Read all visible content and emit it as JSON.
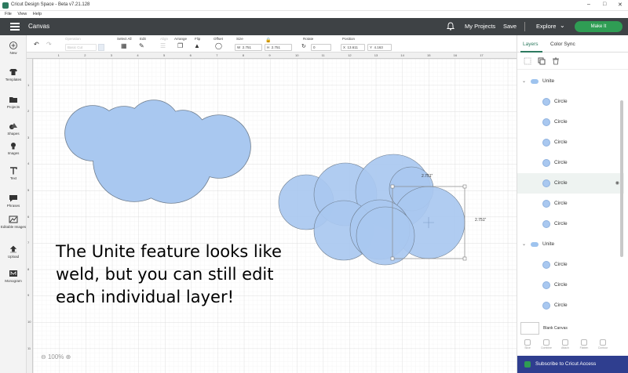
{
  "window": {
    "title": "Cricut Design Space - Beta v7.21.128",
    "menu": [
      "File",
      "View",
      "Help"
    ]
  },
  "header": {
    "canvas_label": "Canvas",
    "my_projects": "My Projects",
    "save": "Save",
    "explore": "Explore",
    "make_it": "Make It"
  },
  "toolbar": {
    "operation_label": "Operation",
    "operation_value": "Basic Cut",
    "select_all": "Select All",
    "edit": "Edit",
    "align": "Align",
    "arrange": "Arrange",
    "flip": "Flip",
    "offset": "Offset",
    "size": "Size",
    "w_label": "W",
    "w_value": "2.751",
    "h_label": "H",
    "h_value": "2.751",
    "rotate": "Rotate",
    "rotate_value": "0",
    "position": "Position",
    "x_label": "X",
    "x_value": "13.611",
    "y_label": "Y",
    "y_value": "4.163"
  },
  "leftbar": [
    {
      "label": "New",
      "icon": "plus-icon"
    },
    {
      "label": "Templates",
      "icon": "shirt-icon"
    },
    {
      "label": "Projects",
      "icon": "folder-icon"
    },
    {
      "label": "Shapes",
      "icon": "shapes-icon"
    },
    {
      "label": "Images",
      "icon": "lightbulb-icon"
    },
    {
      "label": "Text",
      "icon": "text-icon"
    },
    {
      "label": "Phrases",
      "icon": "speech-bubble-icon"
    },
    {
      "label": "Editable Images",
      "icon": "editable-image-icon"
    },
    {
      "label": "Upload",
      "icon": "upload-icon"
    },
    {
      "label": "Monogram",
      "icon": "monogram-icon"
    }
  ],
  "rulers": {
    "top": [
      "1",
      "2",
      "3",
      "4",
      "5",
      "6",
      "7",
      "8",
      "9",
      "10",
      "11",
      "12",
      "13",
      "14",
      "15",
      "16",
      "17"
    ],
    "left": [
      "1",
      "2",
      "3",
      "4",
      "5",
      "6",
      "7",
      "8",
      "9",
      "10",
      "11"
    ]
  },
  "canvas": {
    "overlay_lines": [
      "The Unite feature looks like",
      "weld, but you can still edit",
      "each individual layer!"
    ],
    "zoom": "100%",
    "width_dim": "2.751\"",
    "height_dim": "2.751\"",
    "shape_fill": "#a9c8f0",
    "shape_stroke": "#6e7d8e"
  },
  "panel": {
    "tabs": [
      "Layers",
      "Color Sync"
    ],
    "layers": [
      {
        "type": "group",
        "label": "Unite"
      },
      {
        "type": "item",
        "label": "Circle"
      },
      {
        "type": "item",
        "label": "Circle"
      },
      {
        "type": "item",
        "label": "Circle"
      },
      {
        "type": "item",
        "label": "Circle"
      },
      {
        "type": "item",
        "label": "Circle",
        "selected": true
      },
      {
        "type": "item",
        "label": "Circle"
      },
      {
        "type": "item",
        "label": "Circle"
      },
      {
        "type": "group",
        "label": "Unite"
      },
      {
        "type": "item",
        "label": "Circle"
      },
      {
        "type": "item",
        "label": "Circle"
      },
      {
        "type": "item",
        "label": "Circle"
      }
    ],
    "blank_canvas": "Blank Canvas",
    "bottom_actions": [
      "Slice",
      "Combine",
      "Attach",
      "Flatten",
      "Contour"
    ],
    "subscribe": "Subscribe to Cricut Access"
  }
}
